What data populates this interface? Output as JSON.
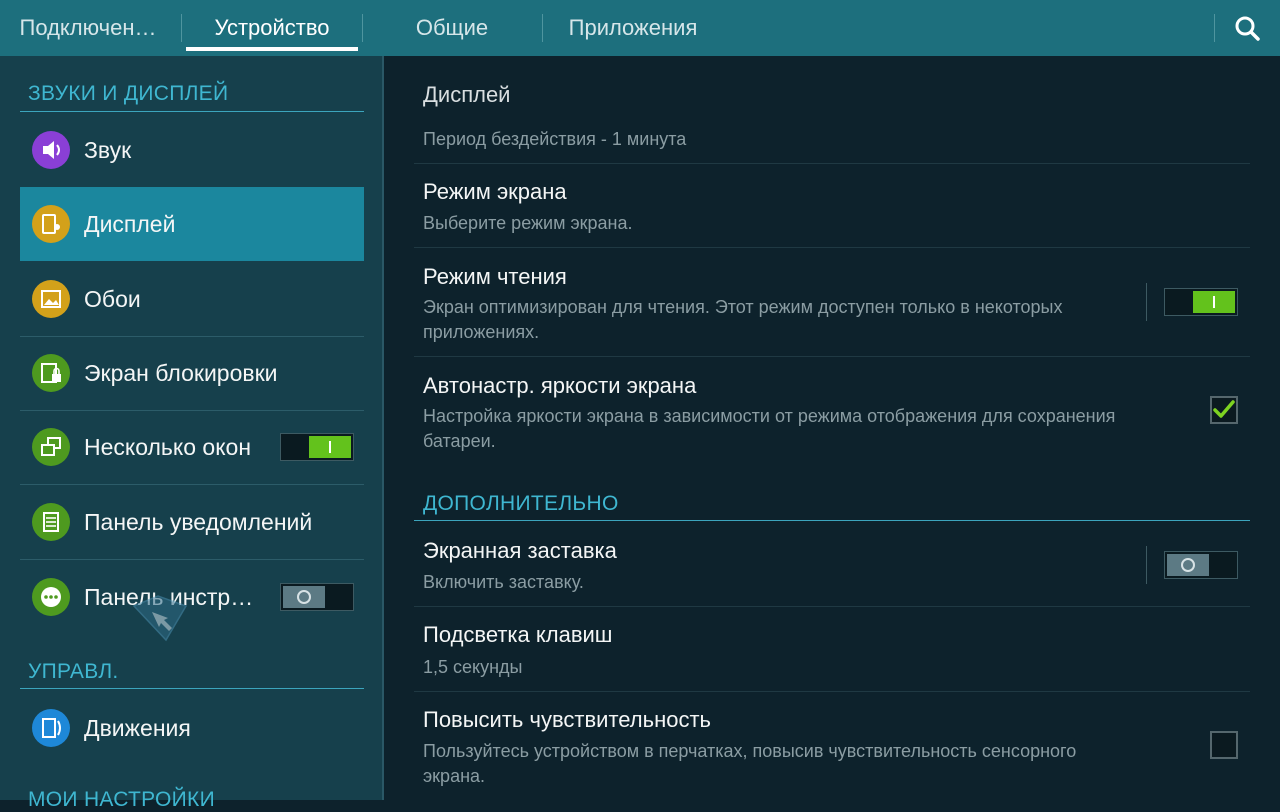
{
  "tabs": [
    {
      "label": "Подключен…"
    },
    {
      "label": "Устройство"
    },
    {
      "label": "Общие"
    },
    {
      "label": "Приложения"
    }
  ],
  "active_tab": 1,
  "sidebar": {
    "sections": [
      {
        "header": "ЗВУКИ И ДИСПЛЕЙ"
      },
      {
        "header": "УПРАВЛ."
      },
      {
        "header": "МОИ НАСТРОЙКИ"
      }
    ],
    "items": [
      {
        "label": "Звук",
        "icon": "speaker-icon",
        "color": "#8a3fd6"
      },
      {
        "label": "Дисплей",
        "icon": "display-icon",
        "color": "#d3a11a",
        "selected": true
      },
      {
        "label": "Обои",
        "icon": "wallpaper-icon",
        "color": "#d3a11a"
      },
      {
        "label": "Экран блокировки",
        "icon": "lock-screen-icon",
        "color": "#4e9a1f"
      },
      {
        "label": "Несколько окон",
        "icon": "multi-window-icon",
        "color": "#4e9a1f",
        "switch": "on"
      },
      {
        "label": "Панель уведомлений",
        "icon": "notification-panel-icon",
        "color": "#4e9a1f"
      },
      {
        "label": "Панель инстр…",
        "icon": "toolbox-icon",
        "color": "#4e9a1f",
        "switch": "off"
      },
      {
        "label": "Движения",
        "icon": "motion-icon",
        "color": "#1e88d8"
      }
    ]
  },
  "main": {
    "title": "Дисплей",
    "first_sub": "Период бездействия - 1 минута",
    "rows": [
      {
        "title": "Режим экрана",
        "sub": "Выберите режим экрана."
      },
      {
        "title": "Режим чтения",
        "sub": "Экран оптимизирован для чтения. Этот режим доступен только в некоторых приложениях.",
        "switch": "on"
      },
      {
        "title": "Автонастр. яркости экрана",
        "sub": "Настройка яркости экрана в зависимости от режима отображения для сохранения батареи.",
        "checked": true
      }
    ],
    "section_header": "ДОПОЛНИТЕЛЬНО",
    "rows2": [
      {
        "title": "Экранная заставка",
        "sub": "Включить заставку.",
        "switch": "off"
      },
      {
        "title": "Подсветка клавиш",
        "sub": "1,5 секунды"
      },
      {
        "title": "Повысить чувствительность",
        "sub": "Пользуйтесь устройством в перчатках, повысив чувствительность сенсорного экрана.",
        "checked": false
      }
    ]
  },
  "colors": {
    "accent": "#3fb7d1",
    "topbar": "#1d6f7d",
    "selected": "#1b879e",
    "switch_on": "#63c21c"
  }
}
